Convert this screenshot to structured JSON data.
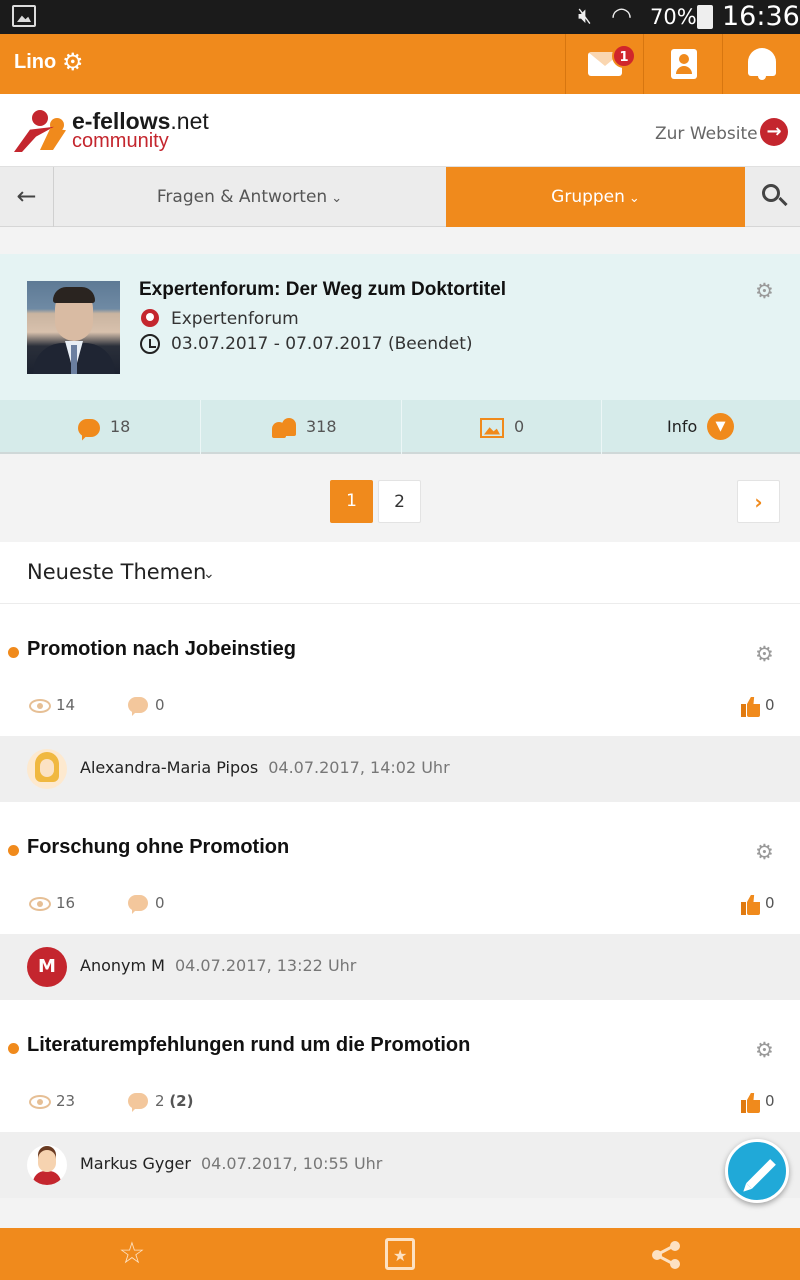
{
  "status_bar": {
    "battery": "70%",
    "time": "16:36",
    "icons": [
      "gallery-icon",
      "mute-icon",
      "wifi-icon",
      "battery-charging-icon"
    ]
  },
  "app_bar": {
    "user_name": "Lino",
    "mail_badge": "1",
    "icons": [
      "settings-icon",
      "mail-icon",
      "contacts-icon",
      "bell-icon"
    ]
  },
  "logo": {
    "brand": "e-fellows",
    "brand_suffix": ".net",
    "sub": "community",
    "website_link": "Zur Website"
  },
  "tabs": {
    "back": "←",
    "qa": "Fragen & Antworten",
    "groups": "Gruppen",
    "active": "groups"
  },
  "group": {
    "title": "Expertenforum: Der Weg zum Doktortitel",
    "type": "Expertenforum",
    "dates": "03.07.2017 - 07.07.2017 (Beendet)"
  },
  "stats": {
    "posts": "18",
    "members": "318",
    "images": "0",
    "info": "Info"
  },
  "pagination": {
    "pages": [
      "1",
      "2"
    ],
    "current": "1",
    "next": "›"
  },
  "section": {
    "title": "Neueste Themen"
  },
  "topics": [
    {
      "title": "Promotion nach Jobeinstieg",
      "views": "14",
      "comments": "0",
      "comments_new": "",
      "likes": "0",
      "author": "Alexandra-Maria Pipos",
      "date": "04.07.2017, 14:02 Uhr"
    },
    {
      "title": "Forschung ohne Promotion",
      "views": "16",
      "comments": "0",
      "comments_new": "",
      "likes": "0",
      "author": "Anonym M",
      "author_initial": "M",
      "date": "04.07.2017, 13:22 Uhr"
    },
    {
      "title": "Literaturempfehlungen rund um die Promotion",
      "views": "23",
      "comments": "2",
      "comments_new": "(2)",
      "likes": "0",
      "author": "Markus Gyger",
      "date": "04.07.2017, 10:55 Uhr"
    }
  ],
  "colors": {
    "accent": "#f08a1c",
    "brand_red": "#c4262e",
    "group_bg": "#e5f3f3",
    "fab": "#20a9d8"
  }
}
